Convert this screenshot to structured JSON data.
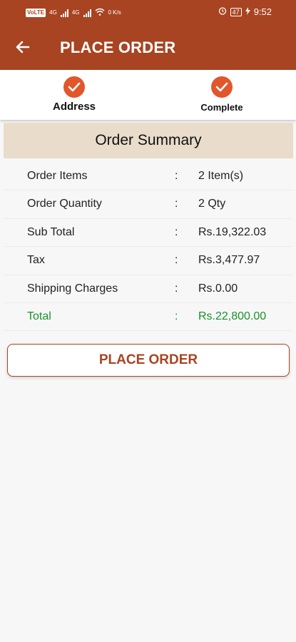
{
  "status_bar": {
    "volte": "VoLTE",
    "sim1": "4G",
    "sim2": "4G",
    "wifi_speed": "0 K/s",
    "battery": "47",
    "time": "9:52"
  },
  "app_bar": {
    "title": "PLACE ORDER",
    "back_icon": "arrow-left-icon"
  },
  "steps": [
    {
      "label": "Address",
      "icon": "check-icon"
    },
    {
      "label": "Complete",
      "icon": "check-icon"
    }
  ],
  "summary": {
    "heading": "Order Summary",
    "separator": ":",
    "rows": [
      {
        "label": "Order Items",
        "value": "2 Item(s)"
      },
      {
        "label": "Order Quantity",
        "value": "2 Qty"
      },
      {
        "label": "Sub Total",
        "value": "Rs.19,322.03"
      },
      {
        "label": "Tax",
        "value": "Rs.3,477.97"
      },
      {
        "label": "Shipping Charges",
        "value": "Rs.0.00"
      },
      {
        "label": "Total",
        "value": "Rs.22,800.00"
      }
    ]
  },
  "actions": {
    "place_order_label": "PLACE ORDER"
  },
  "colors": {
    "primary": "#a84421",
    "accent": "#e2562b",
    "total_green": "#18922c",
    "summary_bg": "#e9dccb"
  }
}
